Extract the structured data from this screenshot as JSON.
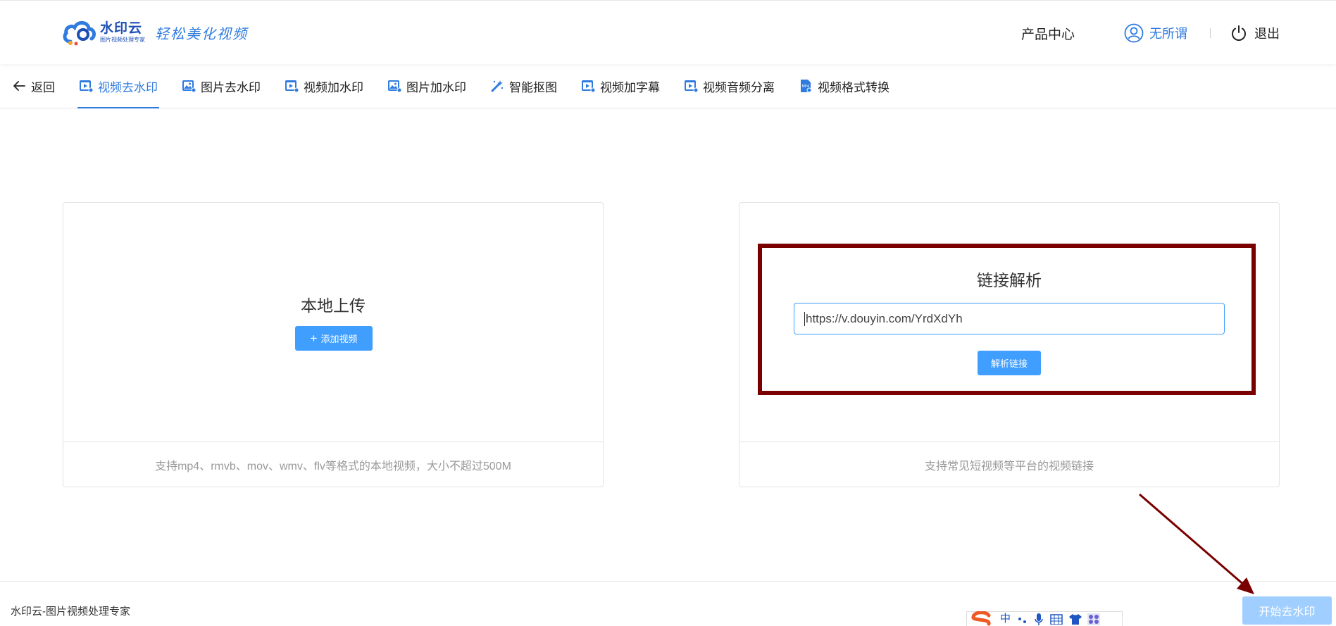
{
  "header": {
    "logo_name": "水印云",
    "logo_sub": "图片视频处理专家",
    "logo_slogan": "轻松美化视频",
    "product_center": "产品中心",
    "username": "无所谓",
    "logout": "退出"
  },
  "tabs": {
    "back": "返回",
    "items": [
      {
        "label": "视频去水印",
        "icon": "video-icon",
        "active": true
      },
      {
        "label": "图片去水印",
        "icon": "image-icon",
        "active": false
      },
      {
        "label": "视频加水印",
        "icon": "video-icon",
        "active": false
      },
      {
        "label": "图片加水印",
        "icon": "image-icon",
        "active": false
      },
      {
        "label": "智能抠图",
        "icon": "magic-wand-icon",
        "active": false
      },
      {
        "label": "视频加字幕",
        "icon": "video-icon",
        "active": false
      },
      {
        "label": "视频音频分离",
        "icon": "video-icon",
        "active": false
      },
      {
        "label": "视频格式转换",
        "icon": "mp4-file-icon",
        "active": false
      }
    ]
  },
  "local_upload": {
    "title": "本地上传",
    "button": "添加视频",
    "footnote": "支持mp4、rmvb、mov、wmv、flv等格式的本地视频，大小不超过500M"
  },
  "link_parse": {
    "title": "链接解析",
    "input_value": "https://v.douyin.com/YrdXdYh",
    "button": "解析链接",
    "footnote": "支持常见短视频等平台的视频链接"
  },
  "footer": {
    "text": "水印云-图片视频处理专家",
    "start_button": "开始去水印"
  },
  "ime": {
    "mode": "中",
    "items": [
      "dots-icon",
      "mic-icon",
      "keyboard-icon",
      "shirt-icon",
      "grid-icon"
    ]
  },
  "colors": {
    "accent": "#2f7be0",
    "primary_button": "#409eff",
    "disabled_button": "#a0cfff",
    "highlight_box": "#7a0000"
  }
}
